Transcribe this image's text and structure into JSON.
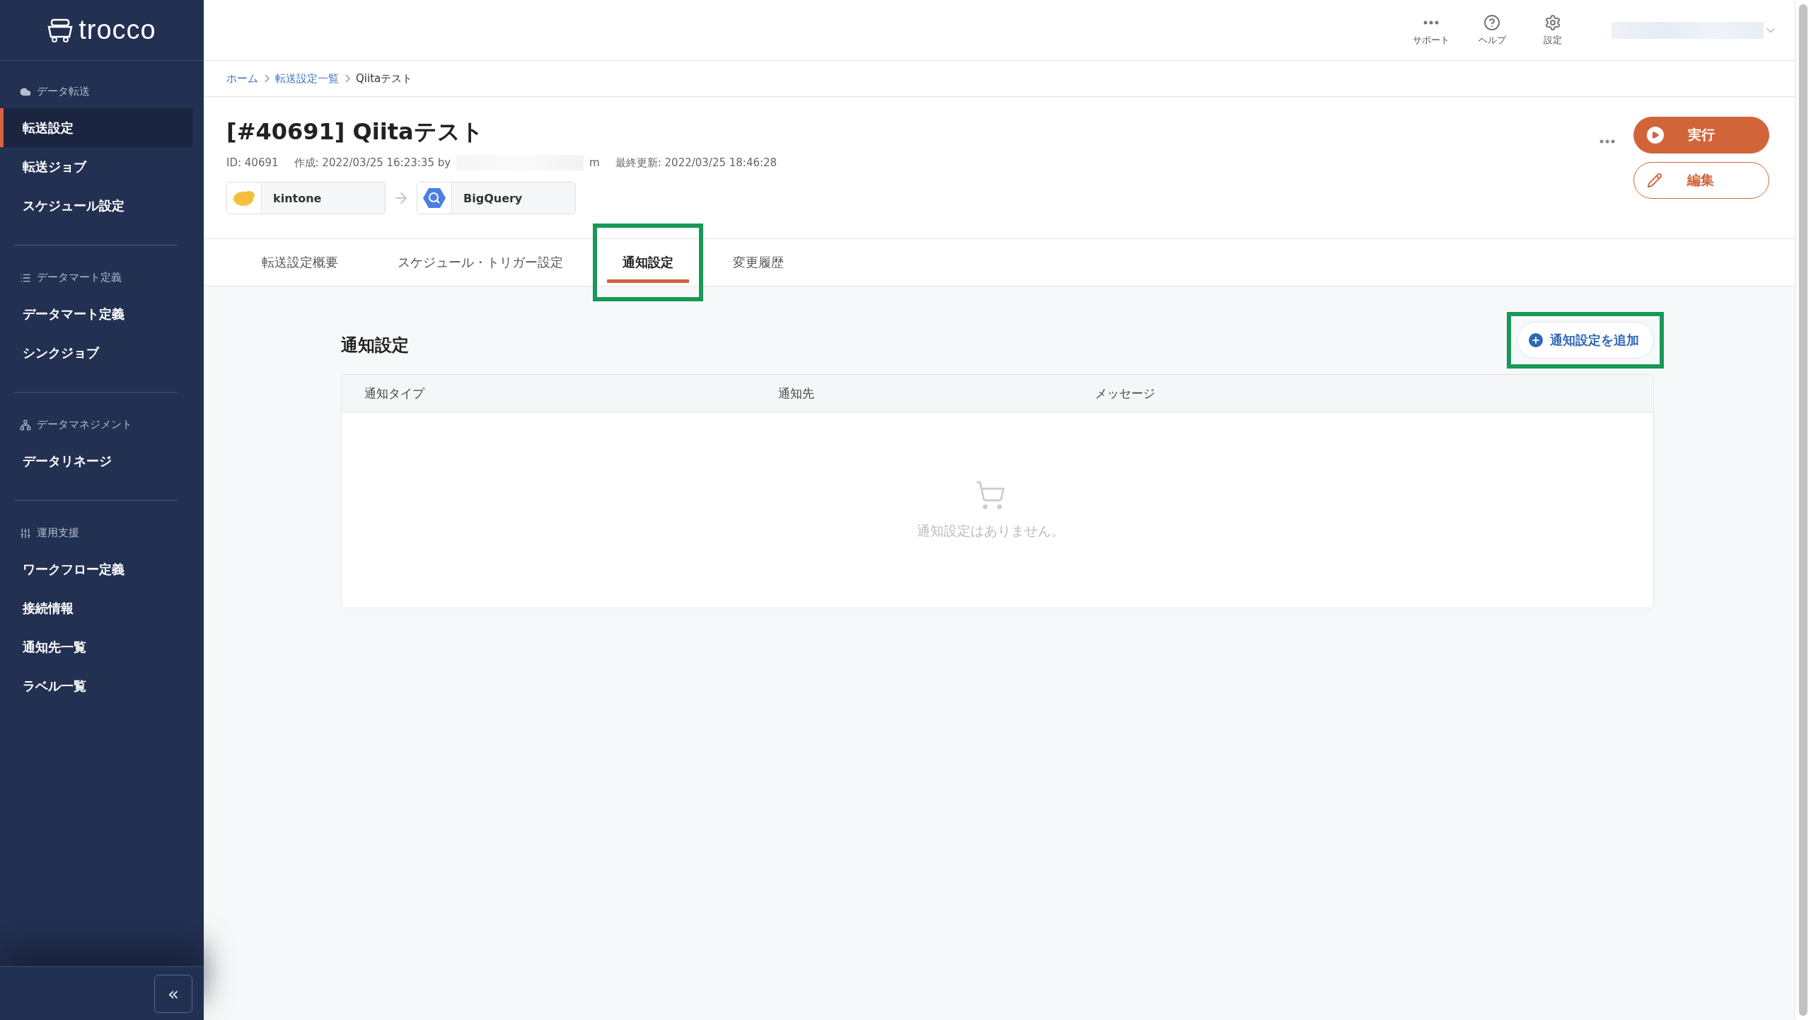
{
  "sidebar": {
    "logo": "trocco",
    "sections": [
      {
        "title": "データ転送",
        "items": [
          {
            "label": "転送設定",
            "selected": true
          },
          {
            "label": "転送ジョブ",
            "selected": false
          },
          {
            "label": "スケジュール設定",
            "selected": false
          }
        ]
      },
      {
        "title": "データマート定義",
        "items": [
          {
            "label": "データマート定義",
            "selected": false
          },
          {
            "label": "シンクジョブ",
            "selected": false
          }
        ]
      },
      {
        "title": "データマネジメント",
        "items": [
          {
            "label": "データリネージ",
            "selected": false
          }
        ]
      },
      {
        "title": "運用支援",
        "items": [
          {
            "label": "ワークフロー定義",
            "selected": false
          },
          {
            "label": "接続情報",
            "selected": false
          },
          {
            "label": "通知先一覧",
            "selected": false
          },
          {
            "label": "ラベル一覧",
            "selected": false
          }
        ]
      }
    ],
    "collapse": "«"
  },
  "header": {
    "actions": [
      {
        "label": "サポート"
      },
      {
        "label": "ヘルプ"
      },
      {
        "label": "設定"
      }
    ]
  },
  "breadcrumb": [
    {
      "label": "ホーム",
      "link": true
    },
    {
      "label": "転送設定一覧",
      "link": true
    },
    {
      "label": "Qiitaテスト",
      "link": false
    }
  ],
  "title": "[#40691] Qiitaテスト",
  "meta": {
    "id": "ID: 40691",
    "created": "作成: 2022/03/25 16:23:35 by",
    "created_tail": "m",
    "updated": "最終更新: 2022/03/25 18:46:28"
  },
  "connectors": [
    {
      "name": "kintone",
      "kind": "kintone"
    },
    {
      "name": "BigQuery",
      "kind": "bigquery"
    }
  ],
  "buttons": [
    {
      "label": "実行",
      "kind": "primary"
    },
    {
      "label": "編集",
      "kind": "outline"
    }
  ],
  "tabs": [
    {
      "label": "転送設定概要",
      "selected": false,
      "highlighted": false
    },
    {
      "label": "スケジュール・トリガー設定",
      "selected": false,
      "highlighted": false
    },
    {
      "label": "通知設定",
      "selected": true,
      "highlighted": true
    },
    {
      "label": "変更履歴",
      "selected": false,
      "highlighted": false
    }
  ],
  "section": {
    "title": "通知設定",
    "add_button": {
      "label": "通知設定を追加",
      "highlighted": true
    },
    "columns": [
      "通知タイプ",
      "通知先",
      "メッセージ"
    ],
    "empty_message": "通知設定はありません。"
  }
}
